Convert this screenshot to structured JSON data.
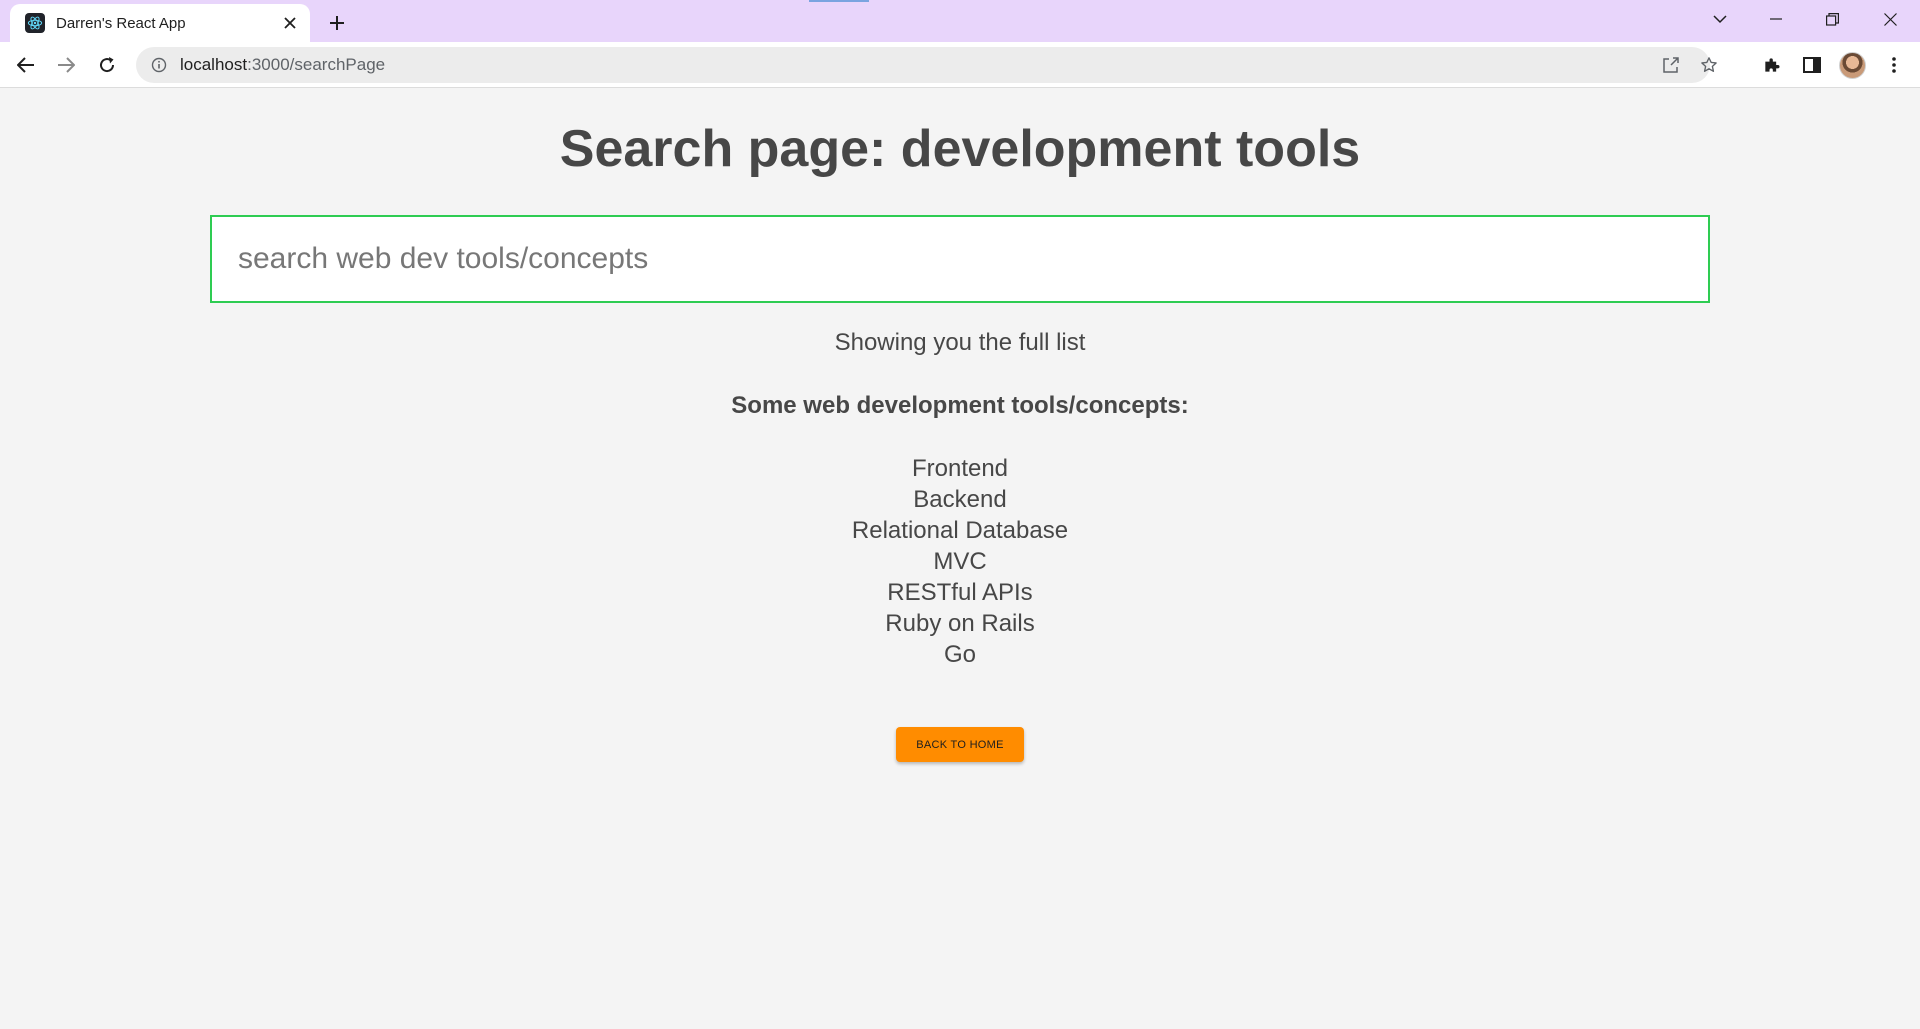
{
  "browser": {
    "tab": {
      "title": "Darren's React App",
      "favicon": "react-logo-icon"
    },
    "url": {
      "host": "localhost",
      "path": ":3000/searchPage"
    },
    "colors": {
      "tabstrip": "#e8d5fb",
      "toolbar": "#ffffff"
    }
  },
  "page": {
    "title": "Search page: development tools",
    "search": {
      "placeholder": "search web dev tools/concepts",
      "value": "",
      "border_color": "#2ecc52"
    },
    "status_text": "Showing you the full list",
    "list_heading": "Some web development tools/concepts:",
    "tools": [
      "Frontend",
      "Backend",
      "Relational Database",
      "MVC",
      "RESTful APIs",
      "Ruby on Rails",
      "Go"
    ],
    "back_button": {
      "label": "BACK TO HOME",
      "color": "#ff8c00"
    }
  }
}
